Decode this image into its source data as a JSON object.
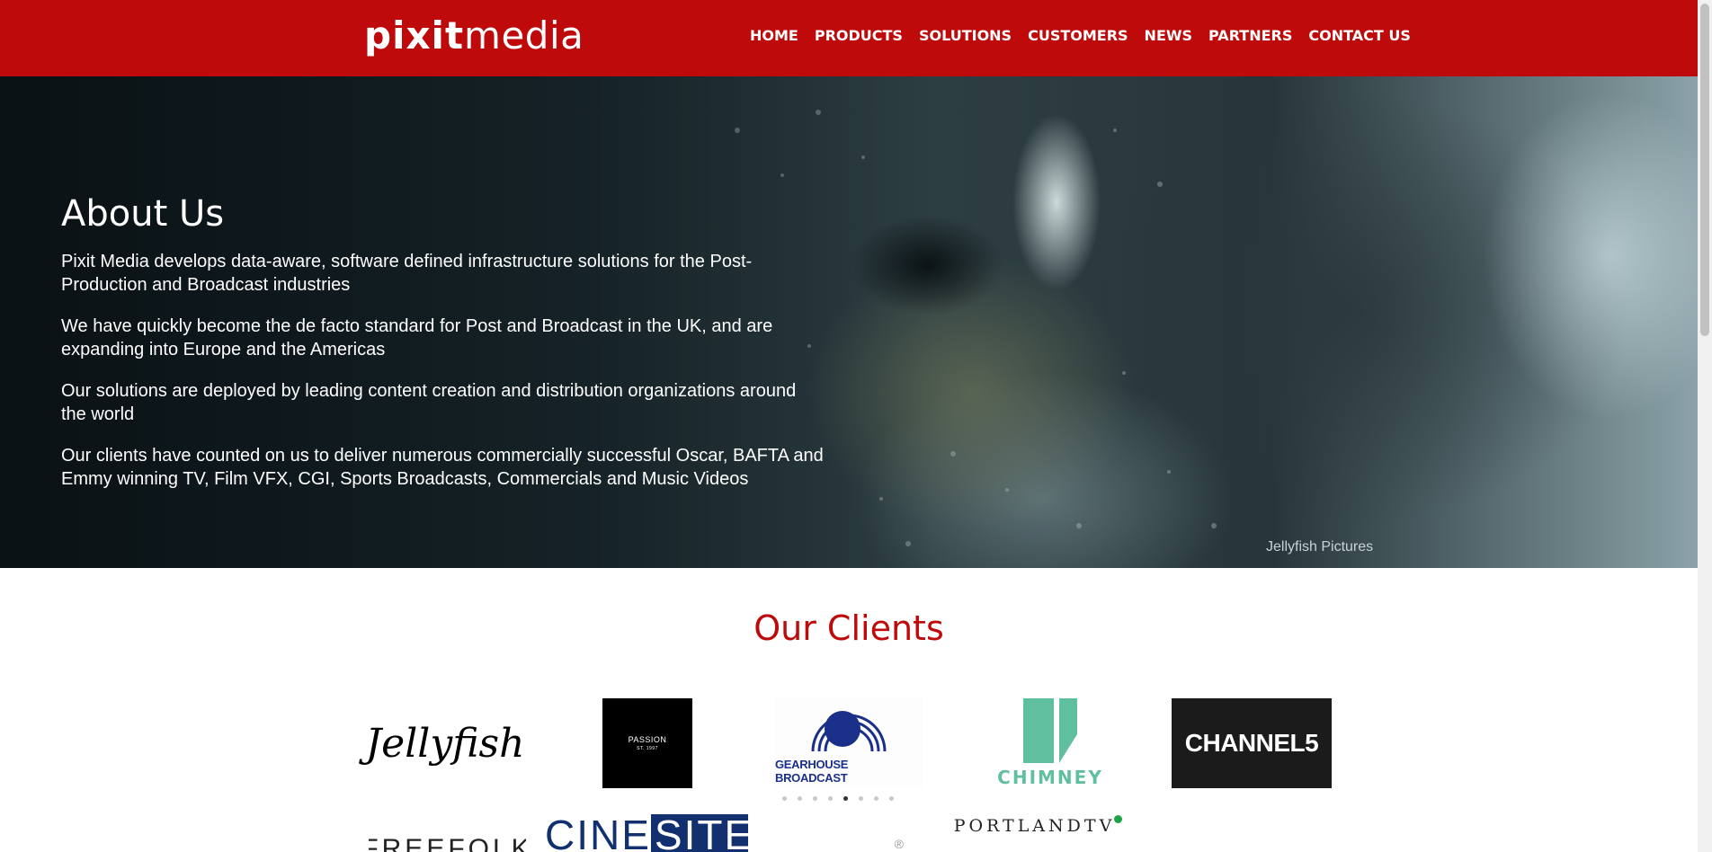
{
  "header": {
    "logo_bold": "pixit",
    "logo_light": "media",
    "nav": [
      "HOME",
      "PRODUCTS",
      "SOLUTIONS",
      "CUSTOMERS",
      "NEWS",
      "PARTNERS",
      "CONTACT US"
    ]
  },
  "hero": {
    "title": "About Us",
    "paragraphs": [
      "Pixit Media develops data-aware, software defined infrastructure solutions for the Post-Production and Broadcast industries",
      "We have quickly become the de facto standard for Post and Broadcast in the UK, and are expanding into Europe and the Americas",
      "Our solutions are deployed by leading content creation and distribution organizations around the world",
      "Our clients have counted on us to deliver numerous commercially successful Oscar, BAFTA and Emmy winning TV, Film VFX, CGI, Sports Broadcasts, Commercials and Music Videos"
    ],
    "credit": "Jellyfish Pictures"
  },
  "clients": {
    "title": "Our Clients",
    "logos": {
      "jellyfish": "Jellyfish",
      "passion": "PASSION",
      "passion_sub": "ST. 1997",
      "gearhouse": "GEARHOUSE BROADCAST",
      "chimney": "CHIMNEY",
      "channel5": "CHANNEL5",
      "freefolk": "FREEFOLK",
      "cinesite_a": "CINE",
      "cinesite_b": "SITE",
      "portland": "PORTLANDTV",
      "faint_mark": "®"
    },
    "carousel": {
      "total": 8,
      "active": 5
    }
  },
  "colors": {
    "brand_red": "#be0a0a",
    "navy": "#12306f",
    "chimney_green": "#5fbf9f",
    "portland_green": "#1fa24a"
  }
}
